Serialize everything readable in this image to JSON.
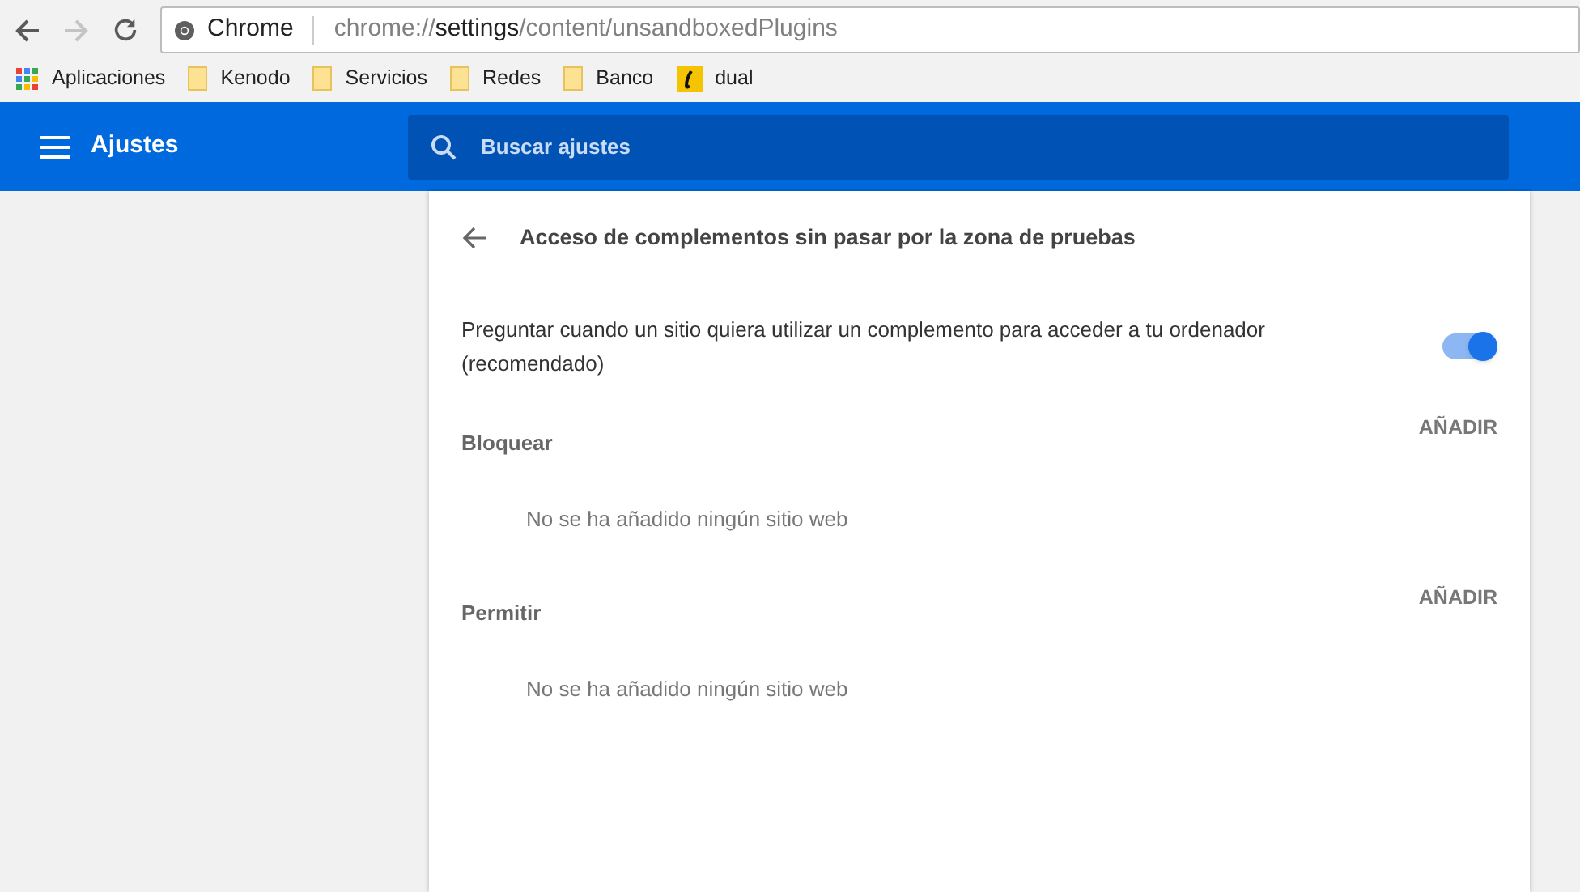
{
  "browser": {
    "site_label": "Chrome",
    "url": {
      "scheme": "chrome://",
      "host": "settings",
      "path": "/content/unsandboxedPlugins"
    },
    "forward_disabled": true
  },
  "bookmarks": [
    {
      "kind": "apps",
      "label": "Aplicaciones"
    },
    {
      "kind": "folder",
      "label": "Kenodo"
    },
    {
      "kind": "folder",
      "label": "Servicios"
    },
    {
      "kind": "folder",
      "label": "Redes"
    },
    {
      "kind": "folder",
      "label": "Banco"
    },
    {
      "kind": "site",
      "label": "dual"
    }
  ],
  "header": {
    "title": "Ajustes",
    "search_placeholder": "Buscar ajustes"
  },
  "page": {
    "title": "Acceso de complementos sin pasar por la zona de pruebas",
    "setting": {
      "label": "Preguntar cuando un sitio quiera utilizar un complemento para acceder a tu ordenador (recomendado)",
      "on": true
    },
    "sections": [
      {
        "title": "Bloquear",
        "action": "AÑADIR",
        "empty_text": "No se ha añadido ningún sitio web"
      },
      {
        "title": "Permitir",
        "action": "AÑADIR",
        "empty_text": "No se ha añadido ningún sitio web"
      }
    ]
  }
}
